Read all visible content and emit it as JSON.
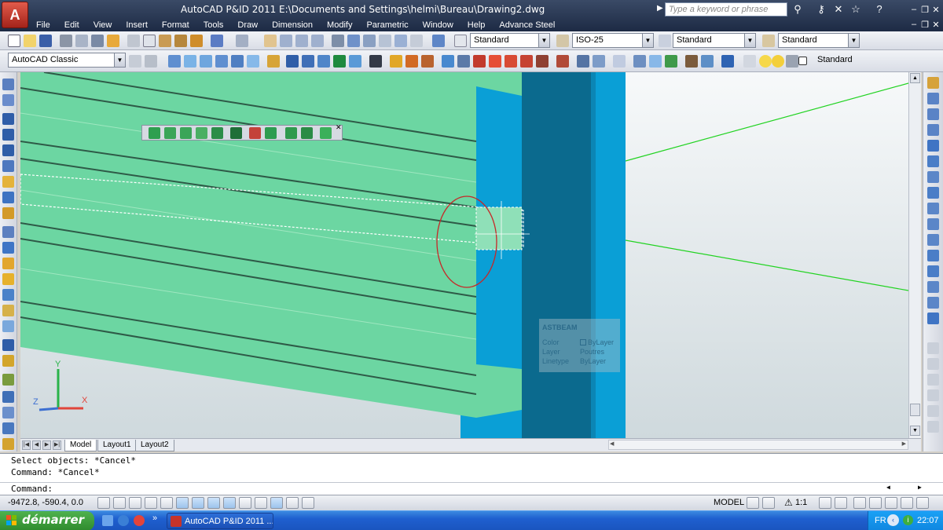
{
  "window": {
    "title": "AutoCAD P&ID 2011     E:\\Documents and Settings\\helmi\\Bureau\\Drawing2.dwg",
    "search_placeholder": "Type a keyword or phrase",
    "app_button_label": "A"
  },
  "menu": [
    "File",
    "Edit",
    "View",
    "Insert",
    "Format",
    "Tools",
    "Draw",
    "Dimension",
    "Modify",
    "Parametric",
    "Window",
    "Help",
    "Advance Steel"
  ],
  "styles_toolbar": {
    "text_style": "Standard",
    "dim_style": "ISO-25",
    "table_style": "Standard",
    "multileader_style": "Standard"
  },
  "workspace_toolbar": {
    "workspace": "AutoCAD Classic",
    "layer_name": "Standard"
  },
  "tooltip": {
    "title": "ASTBEAM",
    "rows": [
      {
        "label": "Color",
        "value": "ByLayer"
      },
      {
        "label": "Layer",
        "value": "Poutres"
      },
      {
        "label": "Linetype",
        "value": "ByLayer"
      }
    ]
  },
  "ucs": {
    "x_label": "X",
    "y_label": "Y",
    "z_label": "Z"
  },
  "layout_tabs": [
    "Model",
    "Layout1",
    "Layout2"
  ],
  "command": {
    "history": [
      "Select objects: *Cancel*",
      "Command: *Cancel*"
    ],
    "prompt": "Command:"
  },
  "status": {
    "coords": "-9472.8,  -590.4, 0.0",
    "model_label": "MODEL",
    "scale": "1:1"
  },
  "taskbar": {
    "start_label": "démarrer",
    "app_label": "AutoCAD P&ID 2011 ...",
    "lang": "FR",
    "clock": "22:07"
  },
  "colors": {
    "steel_green": "#6cd6a2",
    "column_blue": "#0a9fd6",
    "column_dark": "#0b6a8e",
    "guide_line": "#22d322",
    "selection_ellipse": "#c62828"
  }
}
